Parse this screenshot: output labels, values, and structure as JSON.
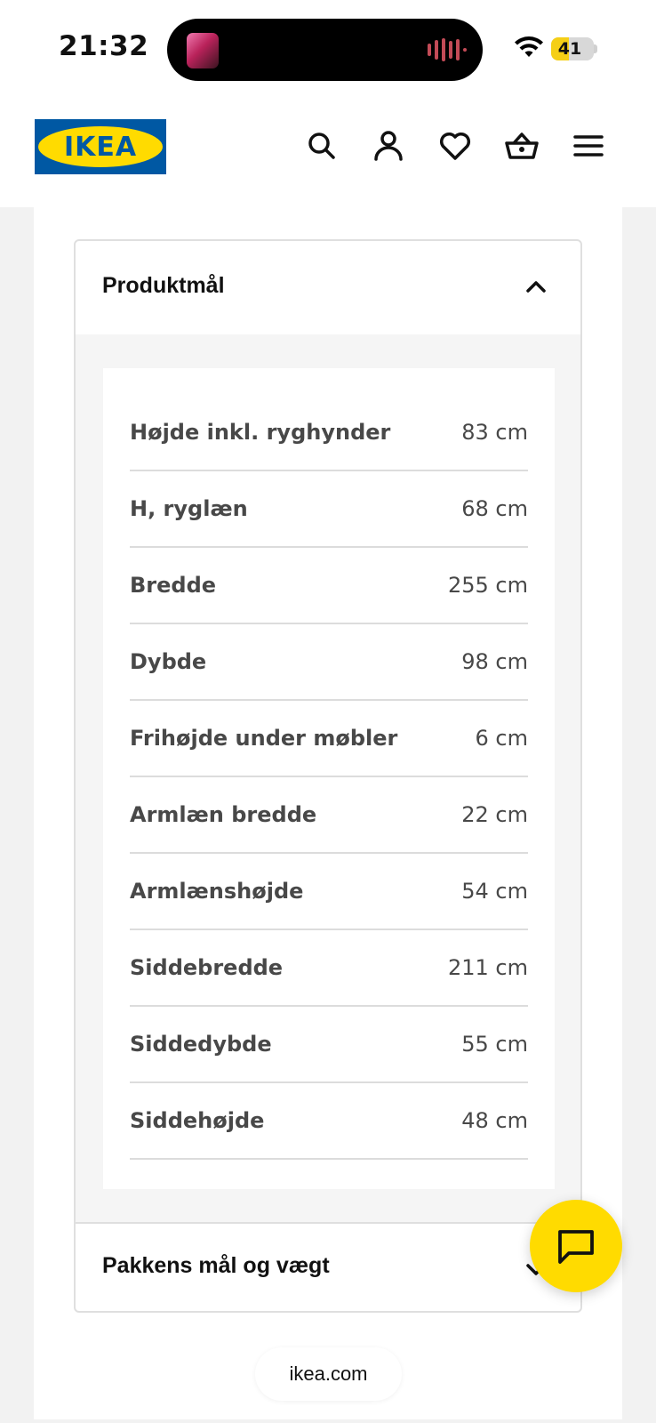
{
  "status_bar": {
    "time": "21:32",
    "battery": "41",
    "battery_level_percent": 41,
    "icons": [
      "now-playing-artwork",
      "audio-waveform-icon",
      "wifi-icon",
      "battery-icon"
    ]
  },
  "header": {
    "logo_text": "IKEA",
    "logo_colors": {
      "background": "#0058a3",
      "ellipse": "#ffdb00",
      "text": "#0058a3"
    },
    "icons": [
      "search-icon",
      "account-icon",
      "favorites-heart-icon",
      "shopping-basket-icon",
      "menu-hamburger-icon"
    ]
  },
  "product_dimensions": {
    "title": "Produktmål",
    "expanded": true,
    "rows": [
      {
        "label": "Højde inkl. ryghynder",
        "value": "83 cm"
      },
      {
        "label": "H, ryglæn",
        "value": "68 cm"
      },
      {
        "label": "Bredde",
        "value": "255 cm"
      },
      {
        "label": "Dybde",
        "value": "98 cm"
      },
      {
        "label": "Frihøjde under møbler",
        "value": "6 cm"
      },
      {
        "label": "Armlæn bredde",
        "value": "22 cm"
      },
      {
        "label": "Armlænshøjde",
        "value": "54 cm"
      },
      {
        "label": "Siddebredde",
        "value": "211 cm"
      },
      {
        "label": "Siddedybde",
        "value": "55 cm"
      },
      {
        "label": "Siddehøjde",
        "value": "48 cm"
      }
    ]
  },
  "package_section": {
    "title": "Pakkens mål og vægt",
    "expanded": false
  },
  "chat": {
    "icon": "chat-bubble-icon",
    "color": "#ffdb00"
  },
  "browser": {
    "url": "ikea.com"
  }
}
